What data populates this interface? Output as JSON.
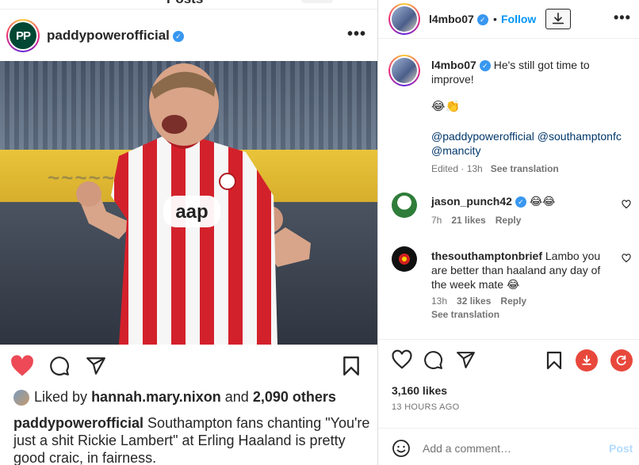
{
  "top_bar": {
    "title": "Posts"
  },
  "left_post": {
    "header": {
      "avatar_text": "PP",
      "username": "paddypowerofficial",
      "more": "•••"
    },
    "actions": {
      "liked": true
    },
    "likes": {
      "prefix": "Liked by",
      "user": "hannah.mary.nixon",
      "middle": "and",
      "others": "2,090 others"
    },
    "caption": {
      "user": "paddypowerofficial",
      "text": "Southampton fans chanting \"You're just a shit Rickie Lambert\" at Erling Haaland is pretty good craic, in fairness."
    },
    "photo": {
      "shirt_sponsor": "aap"
    }
  },
  "right_panel": {
    "header": {
      "username": "l4mbo07",
      "dot": "•",
      "follow_label": "Follow",
      "more": "•••"
    },
    "caption": {
      "username": "l4mbo07",
      "text": "He's still got time to improve!",
      "emoji": "😂👏",
      "tags": "@paddypowerofficial @southamptonfc @mancity",
      "edited": "Edited · 13h",
      "see_translation": "See translation"
    },
    "comments": [
      {
        "username": "jason_punch42",
        "text": "😂😂",
        "time": "7h",
        "likes": "21 likes",
        "reply": "Reply"
      },
      {
        "username": "thesouthamptonbrief",
        "text": "Lambo you are better than haaland any day of the week mate 😂",
        "time": "13h",
        "likes": "32 likes",
        "reply": "Reply",
        "see_translation": "See translation"
      }
    ],
    "likes_count": "3,160 likes",
    "time_ago": "13 HOURS AGO",
    "add_comment": {
      "placeholder": "Add a comment…",
      "post_label": "Post"
    }
  },
  "colors": {
    "accent": "#0095f6",
    "like_red": "#ed4956",
    "download_red": "#e8483b"
  }
}
